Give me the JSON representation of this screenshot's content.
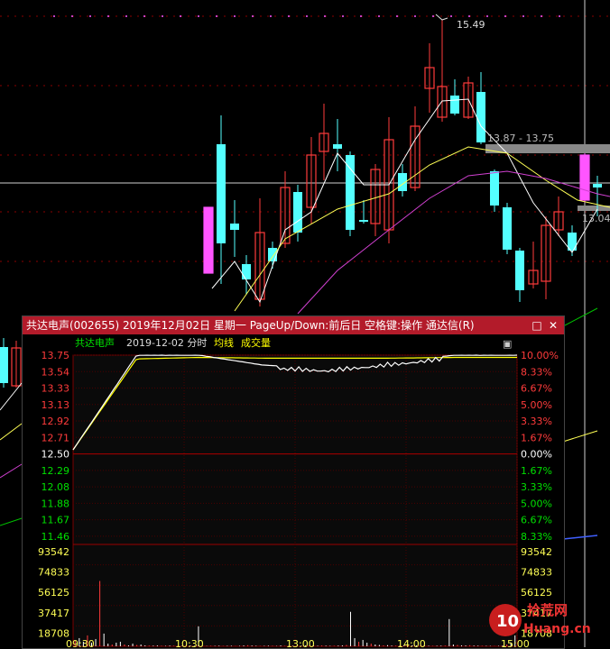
{
  "window": {
    "title": "共达电声(002655) 2019年12月02日 星期一 PageUp/Down:前后日 空格键:操作 通达信(R)",
    "restore_glyph": "□",
    "close_glyph": "✕"
  },
  "minute_panel": {
    "stock_name": "共达电声",
    "date_label": "2019-12-02 分时",
    "avg_label": "均线",
    "volume_label": "成交量",
    "expand_glyph": "▣"
  },
  "kline_labels": {
    "high": "15.49",
    "range": "13.87 - 13.75",
    "right_price": "13.04"
  },
  "chart_data": [
    {
      "type": "line",
      "title": "2019-12-02 分时",
      "x": [
        "09:30",
        "10:30",
        "13:00",
        "14:00",
        "15:00"
      ],
      "series": [
        {
          "name": "price",
          "values": [
            12.5,
            13.75,
            13.75,
            13.62,
            13.58,
            13.66,
            13.75,
            13.75
          ]
        },
        {
          "name": "均线",
          "values": [
            12.5,
            13.7,
            13.72,
            13.71,
            13.71,
            13.71,
            13.72,
            13.72
          ]
        }
      ],
      "price_ticks": [
        "13.75",
        "13.54",
        "13.33",
        "13.13",
        "12.92",
        "12.71",
        "12.50",
        "12.29",
        "12.08",
        "11.88",
        "11.67",
        "11.46"
      ],
      "pct_ticks": [
        "10.00%",
        "8.33%",
        "6.67%",
        "5.00%",
        "3.33%",
        "1.67%",
        "0.00%",
        "1.67%",
        "3.33%",
        "5.00%",
        "6.67%",
        "8.33%"
      ],
      "ylim": [
        11.25,
        13.75
      ],
      "pre_close": 12.5
    },
    {
      "type": "bar",
      "title": "成交量",
      "vol_ticks": [
        "93542",
        "74833",
        "56125",
        "37417",
        "18708"
      ],
      "ylim": [
        0,
        112250
      ],
      "values": [
        6000,
        9000,
        5000,
        12000,
        4000,
        8000,
        72000,
        14000,
        3000,
        2000,
        4000,
        5000,
        2000,
        1000,
        3000,
        1500,
        2000,
        1000,
        800,
        700,
        900,
        600,
        500,
        800,
        600,
        400,
        500,
        700,
        900,
        600,
        22000,
        400,
        300,
        600,
        500,
        700,
        400,
        500,
        600,
        300,
        500,
        900,
        1200,
        800,
        600,
        400,
        500,
        700,
        600,
        400,
        900,
        500,
        600,
        700,
        800,
        600,
        1000,
        800,
        700,
        600,
        900,
        700,
        500,
        600,
        800,
        1000,
        1500,
        38000,
        9000,
        5000,
        7000,
        4000,
        3000,
        2000,
        1500,
        1000,
        1200,
        800,
        700,
        900,
        1000,
        1500,
        1200,
        1000,
        800,
        700,
        600,
        500,
        600,
        700,
        800,
        30000,
        2000,
        1500,
        1000,
        900,
        1200,
        800,
        700,
        600,
        500,
        400,
        300,
        500,
        1000,
        2000,
        4000,
        12000
      ],
      "color": "#ffffff"
    }
  ],
  "colors": {
    "up": "#ff3b3b",
    "down": "#54ffff",
    "price_line": "#ffffff",
    "avg_line": "#ffff00",
    "green_label": "#00e000",
    "magenta": "#ff55ff"
  }
}
